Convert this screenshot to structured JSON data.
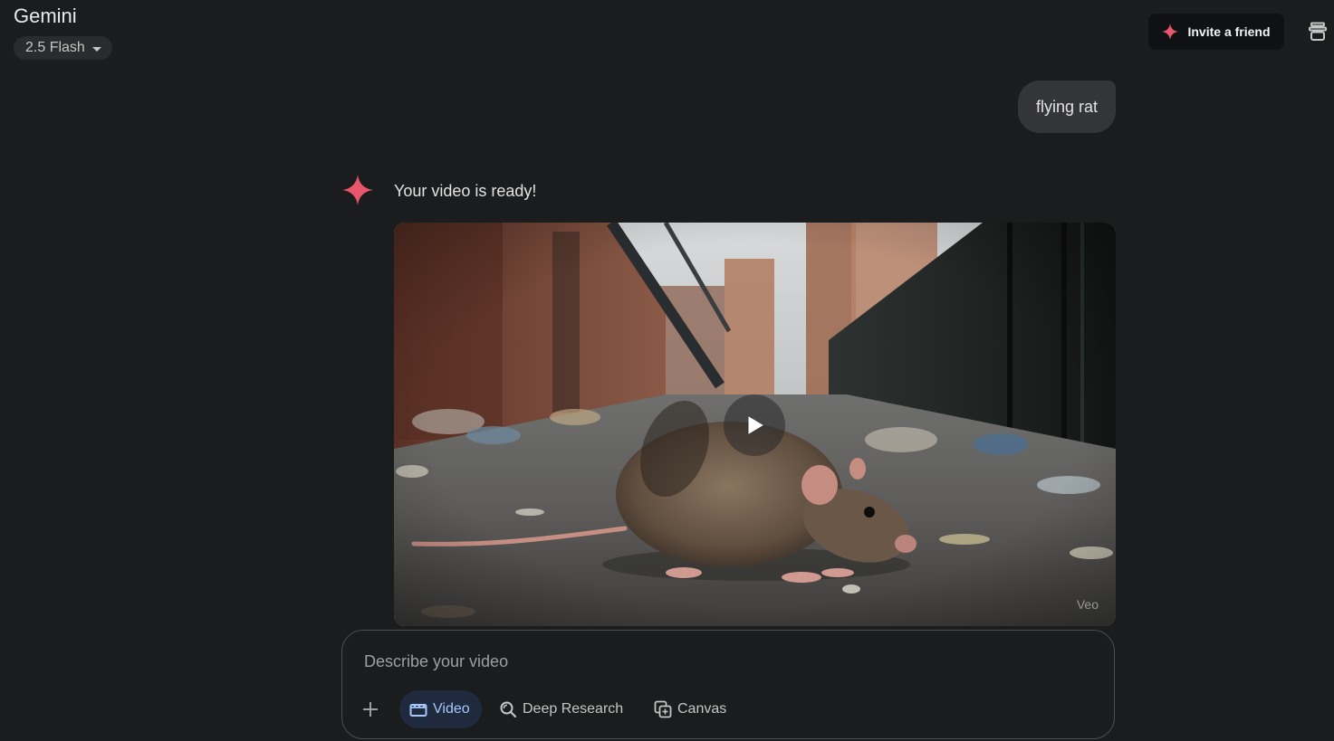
{
  "app": {
    "title": "Gemini",
    "model_label": "2.5 Flash"
  },
  "header": {
    "invite_label": "Invite a friend",
    "invite_icon": "spark-icon",
    "temporary_chat_icon": "temporary-chat-icon"
  },
  "conversation": {
    "user_message": "flying rat",
    "response_text": "Your video is ready!",
    "video": {
      "watermark": "Veo",
      "play_icon": "play-icon"
    }
  },
  "composer": {
    "placeholder": "Describe your video",
    "tools": {
      "add_icon": "plus-icon",
      "video_label": "Video",
      "deep_research_label": "Deep Research",
      "canvas_label": "Canvas"
    }
  },
  "colors": {
    "background": "#1b1c1d",
    "accent_blue": "#a8c7fa",
    "gemini_spark": "#e8566b",
    "bubble": "#333537"
  }
}
